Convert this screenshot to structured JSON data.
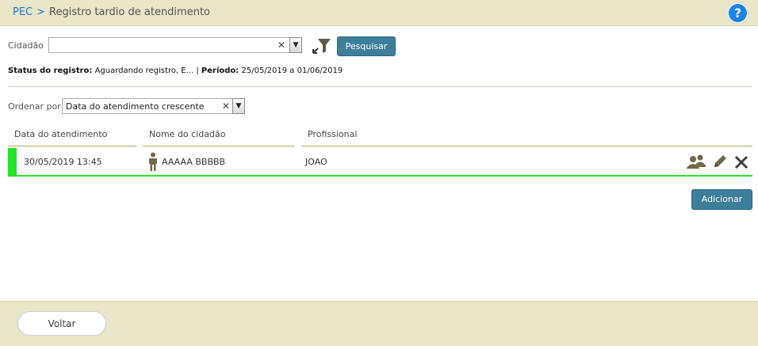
{
  "header": {
    "breadcrumb_root": "PEC",
    "breadcrumb_sep": ">",
    "title": "Registro tardio de atendimento",
    "help_label": "?"
  },
  "filters": {
    "cidadao_label": "Cidadão",
    "cidadao_value": "",
    "search_label": "Pesquisar",
    "status_label": "Status do registro:",
    "status_value": "Aguardando registro, E...",
    "separator": "|",
    "periodo_label": "Período:",
    "periodo_value": "25/05/2019 a 01/06/2019",
    "order_label": "Ordenar por",
    "order_value": "Data do atendimento crescente"
  },
  "table": {
    "columns": [
      "Data do atendimento",
      "Nome do cidadão",
      "Profissional"
    ],
    "rows": [
      {
        "date": "30/05/2019 13:45",
        "citizen": "AAAAA BBBBB",
        "professional": "JOAO"
      }
    ]
  },
  "actions": {
    "add_label": "Adicionar",
    "back_label": "Voltar"
  },
  "colors": {
    "header_bg": "#e8e5c8",
    "accent_blue": "#1b82e6",
    "button_bg": "#3d7e9a",
    "row_status": "#22e622",
    "icon_color": "#6e6a4a"
  },
  "icons": {
    "filter": "filter-expand-icon",
    "person": "person-icon",
    "group": "group-icon",
    "edit": "pencil-icon",
    "delete": "close-icon"
  }
}
